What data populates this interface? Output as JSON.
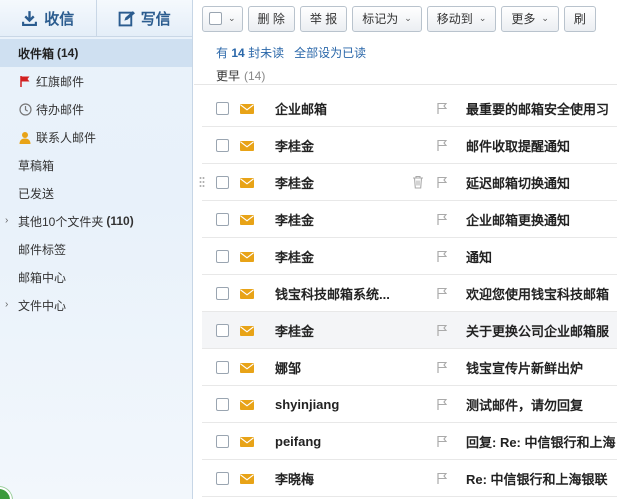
{
  "sidebar": {
    "receive_label": "收信",
    "compose_label": "写信",
    "folders": [
      {
        "label": "收件箱",
        "count": "(14)"
      },
      {
        "label": "红旗邮件"
      },
      {
        "label": "待办邮件"
      },
      {
        "label": "联系人邮件"
      },
      {
        "label": "草稿箱"
      },
      {
        "label": "已发送"
      },
      {
        "label": "其他10个文件夹",
        "count": "(110)"
      },
      {
        "label": "邮件标签"
      },
      {
        "label": "邮箱中心"
      },
      {
        "label": "文件中心"
      }
    ]
  },
  "toolbar": {
    "delete_label": "删 除",
    "report_label": "举 报",
    "mark_label": "标记为",
    "move_label": "移动到",
    "more_label": "更多",
    "refresh_label": "刷"
  },
  "subbar": {
    "unread_prefix": "有",
    "unread_count": "14",
    "unread_suffix": "封未读",
    "mark_all_read": "全部设为已读"
  },
  "group": {
    "label": "更早",
    "count": "(14)"
  },
  "mails": [
    {
      "sender": "企业邮箱",
      "subject": "最重要的邮箱安全使用习"
    },
    {
      "sender": "李桂金",
      "subject": "邮件收取提醒通知"
    },
    {
      "sender": "李桂金",
      "subject": "延迟邮箱切换通知"
    },
    {
      "sender": "李桂金",
      "subject": "企业邮箱更换通知"
    },
    {
      "sender": "李桂金",
      "subject": "通知"
    },
    {
      "sender": "钱宝科技邮箱系统...",
      "subject": "欢迎您使用钱宝科技邮箱"
    },
    {
      "sender": "李桂金",
      "subject": "关于更换公司企业邮箱服"
    },
    {
      "sender": "娜邹",
      "subject": "钱宝宣传片新鲜出炉"
    },
    {
      "sender": "shyinjiang",
      "subject": "测试邮件，请勿回复"
    },
    {
      "sender": "peifang",
      "subject": "回复: Re: 中信银行和上海"
    },
    {
      "sender": "李晓梅",
      "subject": "Re: 中信银行和上海银联"
    }
  ],
  "colors": {
    "accent": "#2a67a9",
    "envelope": "#e8a317",
    "flag": "#d22020"
  }
}
